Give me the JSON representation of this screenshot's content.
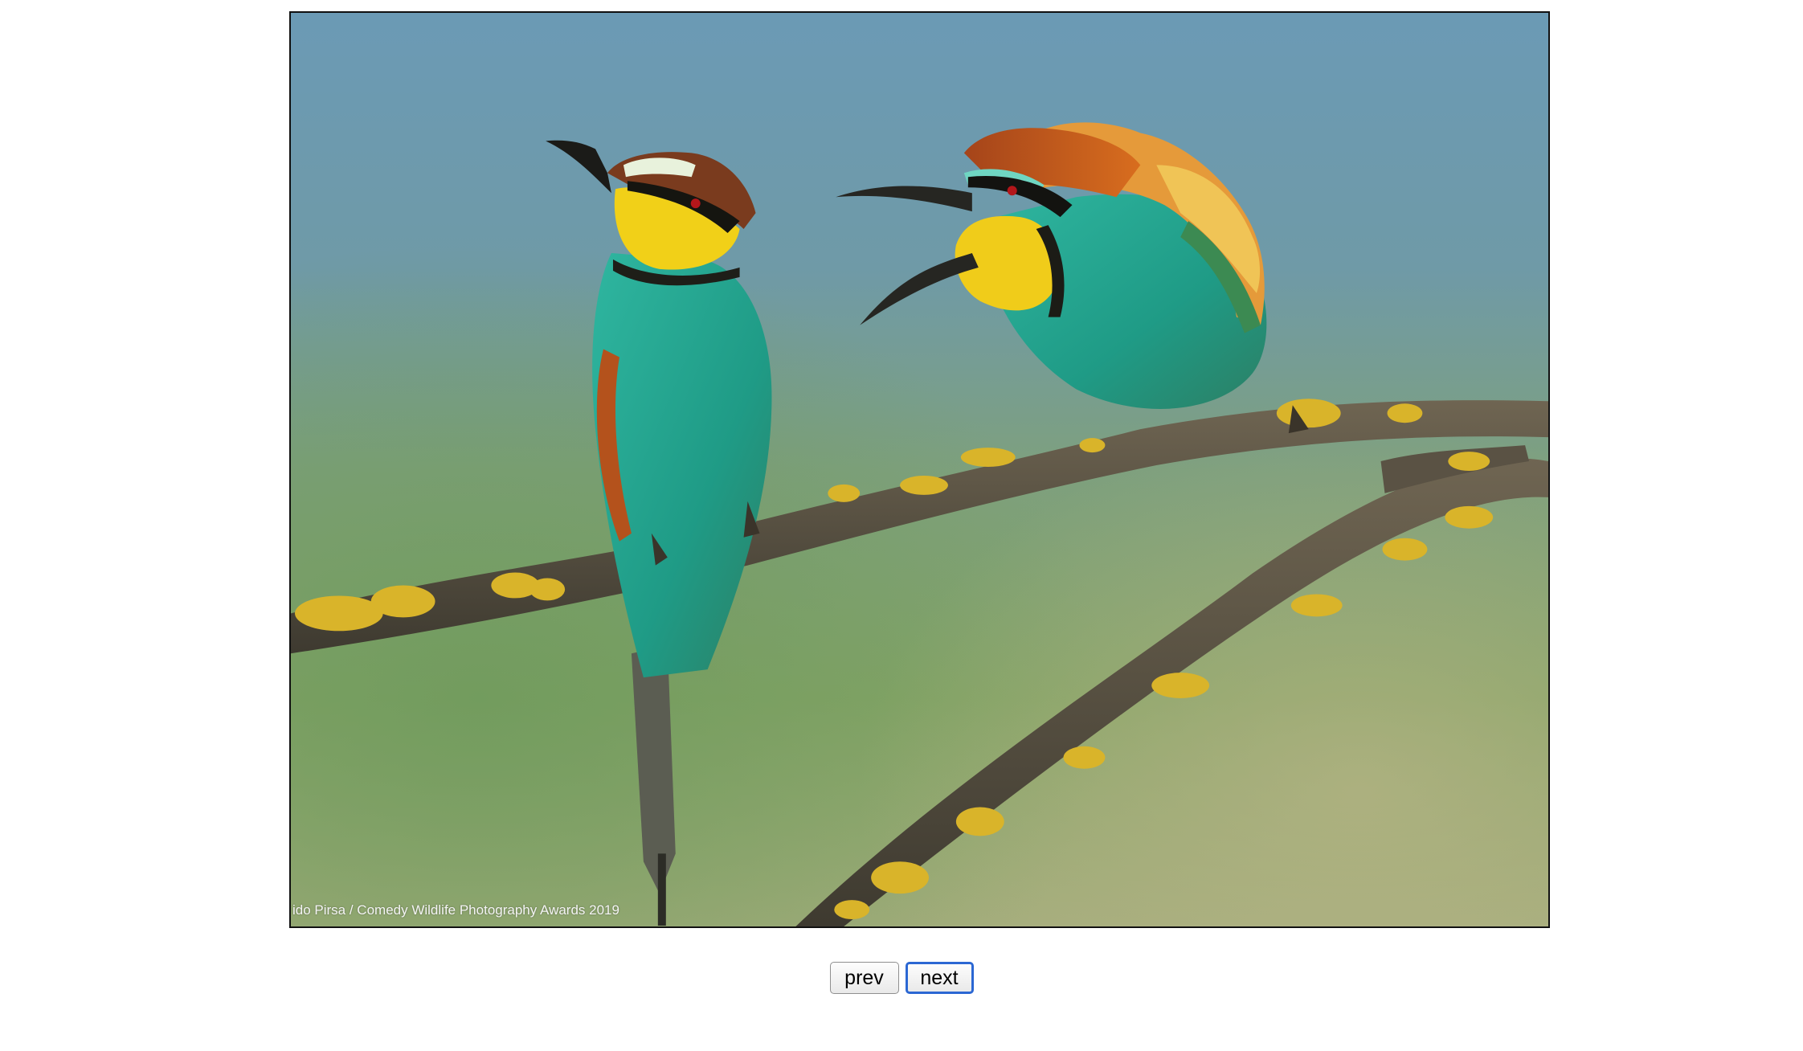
{
  "photo": {
    "caption": "ido Pirsa / Comedy Wildlife Photography Awards 2019",
    "subject": "two European bee-eaters perched on a lichen-covered branch"
  },
  "controls": {
    "prev_label": "prev",
    "next_label": "next"
  },
  "colors": {
    "focus_ring": "#2b67d3",
    "sky": "#6c95ad",
    "meadow": "#7fa06a",
    "lichen": "#d8b52a"
  }
}
